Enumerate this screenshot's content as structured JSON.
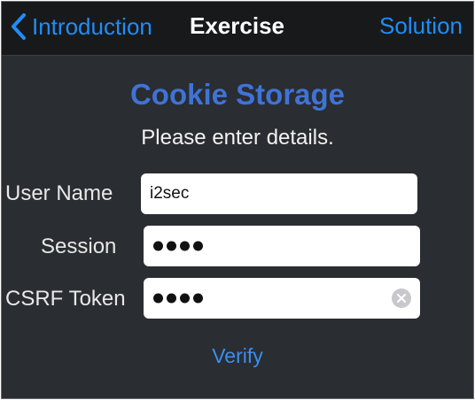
{
  "navbar": {
    "back_label": "Introduction",
    "title": "Exercise",
    "right_label": "Solution"
  },
  "main": {
    "heading": "Cookie Storage",
    "subheading": "Please enter details."
  },
  "form": {
    "user_name": {
      "label": "User Name",
      "value": "i2sec"
    },
    "session": {
      "label": "Session",
      "masked_length": 4
    },
    "csrf_token": {
      "label": "CSRF Token",
      "masked_length": 4
    },
    "verify_label": "Verify"
  },
  "colors": {
    "accent": "#1f8df7",
    "heading": "#3f73d6",
    "background": "#2a2d31",
    "navbar": "#17191b"
  },
  "icons": {
    "back": "chevron-left-icon",
    "clear": "clear-icon"
  }
}
